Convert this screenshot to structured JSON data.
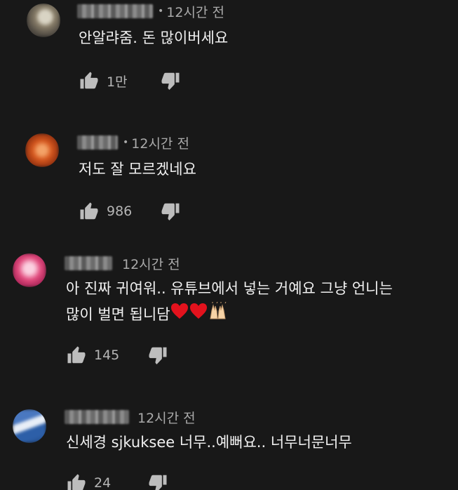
{
  "comments": [
    {
      "time": "12시간 전",
      "text": "안알랴줌. 돈 많이버세요",
      "likes": "1만",
      "avatar_colors": [
        "#8a7f6a",
        "#c9c3b0",
        "#3d3a35"
      ]
    },
    {
      "time": "12시간 전",
      "text": "저도 잘 모르겠네요",
      "likes": "986",
      "avatar_colors": [
        "#d5571e",
        "#f08a3a",
        "#7a2a10"
      ]
    },
    {
      "time": "12시간 전",
      "text_line1": "아 진짜 귀여워.. 유튜브에서 넣는 거예요 그냥 언니는",
      "text_line2": "많이 벌면 됩니담",
      "emoji": "❤❤🙌",
      "likes": "145",
      "avatar_colors": [
        "#e24a7d",
        "#f4a3c3",
        "#b3245a"
      ]
    },
    {
      "time": "12시간 전",
      "text": "신세경 sjkuksee 너무..예뻐요.. 너무너문너무",
      "likes": "24",
      "avatar_colors": [
        "#2d5fa8",
        "#e8eef7",
        "#1a3d70"
      ]
    }
  ],
  "icons": {
    "like": "thumbs-up-icon",
    "dislike": "thumbs-down-icon"
  }
}
